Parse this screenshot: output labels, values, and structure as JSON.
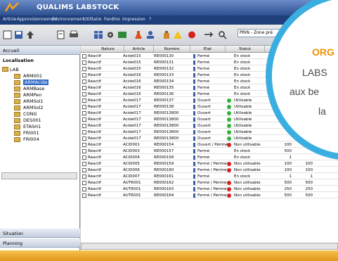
{
  "window": {
    "title": "QUALIMS LABSTOCK"
  },
  "menu": [
    "Article",
    "Approvisionnement",
    "Environnement",
    "Utilitaire",
    "Fenêtre",
    "Impression",
    "?"
  ],
  "filter": {
    "value": "PRIN - Zone pré"
  },
  "left_panel": {
    "header": "Accueil",
    "section": "Localisation",
    "root": "LAB",
    "items": [
      "ARM001",
      "ARMAcide",
      "ARMBase",
      "ARMPen",
      "ARMSol1",
      "ARMSol2",
      "CONG",
      "DES001",
      "ETASH1",
      "FRI001",
      "FRI004"
    ],
    "selected_index": 1,
    "footer_tabs": [
      "Situation",
      "Planning"
    ]
  },
  "grid": {
    "columns": [
      "Nature",
      "Article",
      "Numéro",
      "Etat",
      "Statut",
      "Q"
    ],
    "rows": [
      [
        "Réactif",
        "Acide015",
        "RE000130",
        "Fermé",
        "En stock",
        "",
        ""
      ],
      [
        "Réactif",
        "Acide015",
        "RE000131",
        "Fermé",
        "En stock",
        "",
        ""
      ],
      [
        "Réactif",
        "Acide015",
        "RE000132",
        "Fermé",
        "En stock",
        "",
        ""
      ],
      [
        "Réactif",
        "Acide016",
        "RE000133",
        "Fermé",
        "En stock",
        "",
        ""
      ],
      [
        "Réactif",
        "Acide016",
        "RE000134",
        "Fermé",
        "En stock",
        "",
        ""
      ],
      [
        "Réactif",
        "Acide016",
        "RE000135",
        "Fermé",
        "En stock",
        "",
        ""
      ],
      [
        "Réactif",
        "Acide016",
        "RE000136",
        "Fermé",
        "En stock",
        "",
        ""
      ],
      [
        "Réactif",
        "Acide017",
        "RE000137",
        "Ouvert",
        "Utilisable",
        "",
        ""
      ],
      [
        "Réactif",
        "Acide017",
        "RE000138",
        "Ouvert",
        "Utilisable",
        "",
        ""
      ],
      [
        "Réactif",
        "Acide017",
        "RE00013800",
        "Ouvert",
        "Utilisable",
        "",
        ""
      ],
      [
        "Réactif",
        "Acide017",
        "RE00013800",
        "Ouvert",
        "Utilisable",
        "",
        ""
      ],
      [
        "Réactif",
        "Acide017",
        "RE00013800",
        "Ouvert",
        "Utilisable",
        "",
        ""
      ],
      [
        "Réactif",
        "Acide017",
        "RE00013800",
        "Ouvert",
        "Utilisable",
        "",
        ""
      ],
      [
        "Réactif",
        "Acide017",
        "RE00013800",
        "Ouvert",
        "Utilisable",
        "",
        ""
      ],
      [
        "Réactif",
        "ACID001",
        "RE000154",
        "Ouvert / Périmé",
        "Non utilisable",
        "100",
        ""
      ],
      [
        "Réactif",
        "ACID003",
        "RE000157",
        "Fermé",
        "En stock",
        "500",
        ""
      ],
      [
        "Réactif",
        "ACID004",
        "RE000158",
        "Fermé",
        "En stock",
        "1",
        ""
      ],
      [
        "Réactif",
        "ACID005",
        "RE000159",
        "Fermé / Périmé",
        "Non utilisable",
        "100",
        "100"
      ],
      [
        "Réactif",
        "ACID006",
        "RE000160",
        "Fermé / Périmé",
        "Non utilisable",
        "100",
        "100"
      ],
      [
        "Réactif",
        "ACID007",
        "RE000161",
        "Fermé",
        "En stock",
        "1",
        "1"
      ],
      [
        "Réactif",
        "AUTR001",
        "RE000162",
        "Fermé / Périmé",
        "Non utilisable",
        "500",
        "500"
      ],
      [
        "Réactif",
        "AUTR001",
        "RE000163",
        "Fermé / Périmé",
        "Non utilisable",
        "250",
        "250"
      ],
      [
        "Réactif",
        "AUTR001",
        "RE000164",
        "Fermé / Périmé",
        "Non utilisable",
        "500",
        "500"
      ]
    ]
  },
  "badge": {
    "heading": "ORG",
    "lines": [
      "LABS",
      "aux be",
      "la"
    ]
  },
  "colors": {
    "titlebar": "#2c4f8e",
    "badge_ring": "#3aaee0",
    "heading": "#f29100",
    "ok": "#2fb536",
    "bad": "#d62020",
    "bottom": "#e8a32a"
  }
}
